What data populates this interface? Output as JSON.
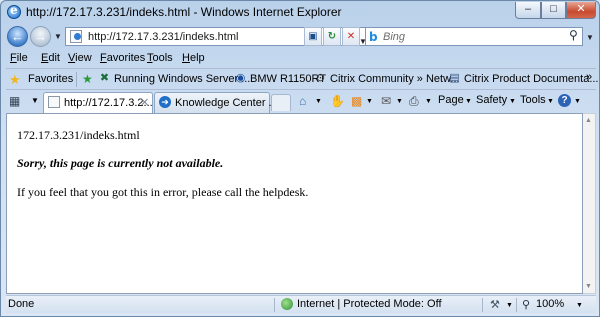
{
  "window": {
    "title": "http://172.17.3.231/indeks.html - Windows Internet Explorer",
    "min_label": "‒",
    "max_label": "□",
    "close_label": "✕"
  },
  "address_bar": {
    "url": "http://172.17.3.231/indeks.html",
    "search_placeholder": "Bing"
  },
  "menu": {
    "file": "ile",
    "file_u": "F",
    "edit": "dit",
    "edit_u": "E",
    "view": "iew",
    "view_u": "V",
    "favorites": "avorites",
    "favorites_u": "F",
    "tools": "ools",
    "tools_u": "T",
    "help": "elp",
    "help_u": "H"
  },
  "favorites_bar": {
    "label": "Favorites",
    "links": [
      "Running Windows Server ...",
      "BMW R1150RT",
      "Citrix Community » Netw...",
      "Citrix Product Documenta..."
    ]
  },
  "tabs": [
    {
      "label": "http://172.17.3.2..."
    },
    {
      "label": "Knowledge Center ..."
    }
  ],
  "command_bar": {
    "page": "Page",
    "safety": "Safety",
    "tools": "Tools"
  },
  "page": {
    "url_text": "172.17.3.231/indeks.html",
    "sorry": "Sorry, this page is currently not available.",
    "help": "If you feel that you got this in error, please call the helpdesk."
  },
  "status": {
    "left": "Done",
    "zone": "Internet | Protected Mode: Off",
    "zoom": "100%"
  },
  "colors": {
    "chrome": "#dbe6f4",
    "close_button": "#c74a2f",
    "link_blue": "#1e8ce0"
  }
}
